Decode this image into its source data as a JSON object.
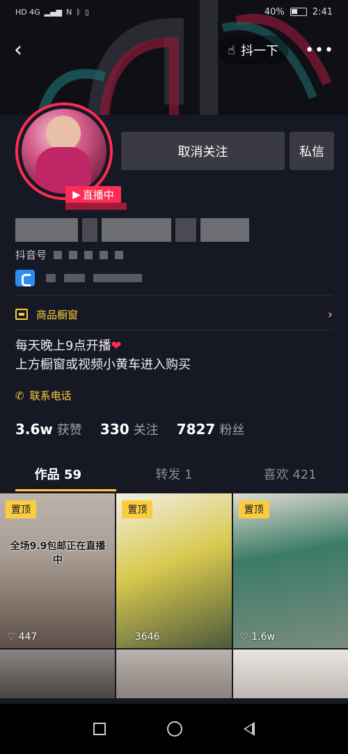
{
  "status": {
    "left_text": "HD 4G",
    "battery": "40%",
    "time": "2:41"
  },
  "header": {
    "shake_label": "抖一下",
    "more_label": "•••"
  },
  "profile": {
    "live_badge": "直播中",
    "unfollow_label": "取消关注",
    "message_label": "私信",
    "douyin_id_label": "抖音号",
    "shop_window_label": "商品橱窗",
    "bio_line1": "每天晚上9点开播",
    "bio_line2": "上方橱窗或视频小黄车进入购买",
    "contact_label": "联系电话"
  },
  "stats": [
    {
      "value": "3.6w",
      "label": "获赞"
    },
    {
      "value": "330",
      "label": "关注"
    },
    {
      "value": "7827",
      "label": "粉丝"
    }
  ],
  "tabs": [
    {
      "label": "作品 59"
    },
    {
      "label": "转发 1"
    },
    {
      "label": "喜欢 421"
    }
  ],
  "videos": [
    {
      "pinned": "置顶",
      "caption": "全场9.9包邮正在直播中",
      "likes": "447"
    },
    {
      "pinned": "置顶",
      "caption": "",
      "likes": "3646"
    },
    {
      "pinned": "置顶",
      "caption": "",
      "likes": "1.6w"
    }
  ],
  "icons": {
    "back": "back-arrow-icon",
    "shake": "hand-point-icon",
    "more": "more-dots-icon",
    "shop": "shop-window-icon",
    "phone": "phone-icon",
    "heart": "heart-icon",
    "link": "link-app-icon"
  },
  "colors": {
    "accent_yellow": "#facd41",
    "live_pink": "#fe2c55",
    "background": "#161823"
  }
}
